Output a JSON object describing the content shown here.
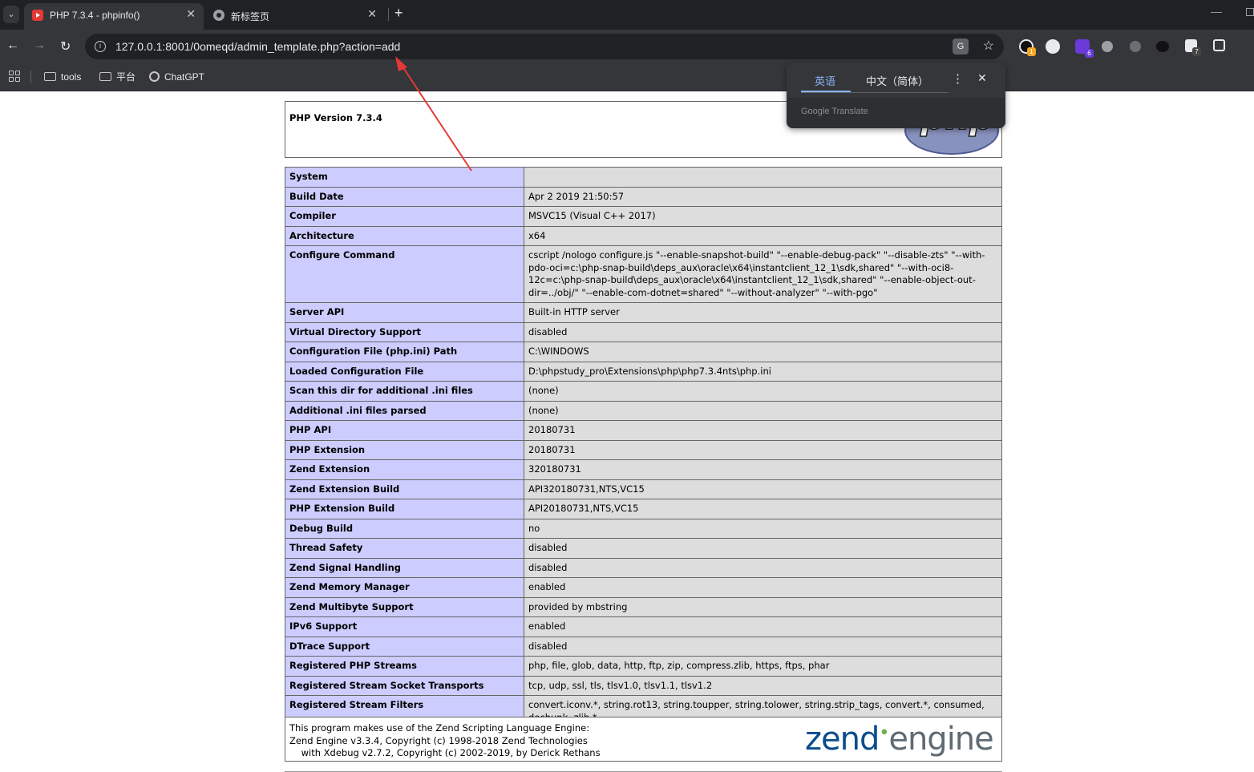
{
  "browser": {
    "tabs": [
      {
        "title": "PHP 7.3.4 - phpinfo()",
        "active": true
      },
      {
        "title": "新标签页",
        "active": false
      }
    ],
    "url": "127.0.0.1:8001/0omeqd/admin_template.php?action=add",
    "bookmarks": [
      "tools",
      "平台",
      "ChatGPT"
    ],
    "extension_badges": [
      "1",
      "6",
      "7"
    ],
    "icons": {
      "tab_list": "chevron-down-icon",
      "new_tab": "plus-icon",
      "site_info": "info-icon",
      "translate": "translate-icon",
      "bookmark_star": "star-icon",
      "apps": "apps-grid-icon",
      "folder": "folder-icon"
    }
  },
  "translate_popup": {
    "source_lang": "英语",
    "target_lang": "中文（简体）",
    "brand": "Google Translate"
  },
  "phpinfo": {
    "version": "PHP Version 7.3.4",
    "logo_text": "php",
    "rows": [
      {
        "key": "System",
        "value": ""
      },
      {
        "key": "Build Date",
        "value": "Apr 2 2019 21:50:57"
      },
      {
        "key": "Compiler",
        "value": "MSVC15 (Visual C++ 2017)"
      },
      {
        "key": "Architecture",
        "value": "x64"
      },
      {
        "key": "Configure Command",
        "value": "cscript /nologo configure.js \"--enable-snapshot-build\" \"--enable-debug-pack\" \"--disable-zts\" \"--with-pdo-oci=c:\\php-snap-build\\deps_aux\\oracle\\x64\\instantclient_12_1\\sdk,shared\" \"--with-oci8-12c=c:\\php-snap-build\\deps_aux\\oracle\\x64\\instantclient_12_1\\sdk,shared\" \"--enable-object-out-dir=../obj/\" \"--enable-com-dotnet=shared\" \"--without-analyzer\" \"--with-pgo\""
      },
      {
        "key": "Server API",
        "value": "Built-in HTTP server"
      },
      {
        "key": "Virtual Directory Support",
        "value": "disabled"
      },
      {
        "key": "Configuration File (php.ini) Path",
        "value": "C:\\WINDOWS"
      },
      {
        "key": "Loaded Configuration File",
        "value": "D:\\phpstudy_pro\\Extensions\\php\\php7.3.4nts\\php.ini"
      },
      {
        "key": "Scan this dir for additional .ini files",
        "value": "(none)"
      },
      {
        "key": "Additional .ini files parsed",
        "value": "(none)"
      },
      {
        "key": "PHP API",
        "value": "20180731"
      },
      {
        "key": "PHP Extension",
        "value": "20180731"
      },
      {
        "key": "Zend Extension",
        "value": "320180731"
      },
      {
        "key": "Zend Extension Build",
        "value": "API320180731,NTS,VC15"
      },
      {
        "key": "PHP Extension Build",
        "value": "API20180731,NTS,VC15"
      },
      {
        "key": "Debug Build",
        "value": "no"
      },
      {
        "key": "Thread Safety",
        "value": "disabled"
      },
      {
        "key": "Zend Signal Handling",
        "value": "disabled"
      },
      {
        "key": "Zend Memory Manager",
        "value": "enabled"
      },
      {
        "key": "Zend Multibyte Support",
        "value": "provided by mbstring"
      },
      {
        "key": "IPv6 Support",
        "value": "enabled"
      },
      {
        "key": "DTrace Support",
        "value": "disabled"
      },
      {
        "key": "Registered PHP Streams",
        "value": "php, file, glob, data, http, ftp, zip, compress.zlib, https, ftps, phar"
      },
      {
        "key": "Registered Stream Socket Transports",
        "value": "tcp, udp, ssl, tls, tlsv1.0, tlsv1.1, tlsv1.2"
      },
      {
        "key": "Registered Stream Filters",
        "value": "convert.iconv.*, string.rot13, string.toupper, string.tolower, string.strip_tags, convert.*, consumed, dechunk, zlib.*"
      }
    ],
    "zend_text": "This program makes use of the Zend Scripting Language Engine:\nZend Engine v3.3.4, Copyright (c) 1998-2018 Zend Technologies\n    with Xdebug v2.7.2, Copyright (c) 2002-2019, by Derick Rethans",
    "zend_logo": {
      "left": "zend",
      "right": "engine"
    }
  },
  "colors": {
    "key_cell": "#ccccff",
    "value_cell": "#dddddd",
    "annotation_arrow": "#e53935"
  }
}
